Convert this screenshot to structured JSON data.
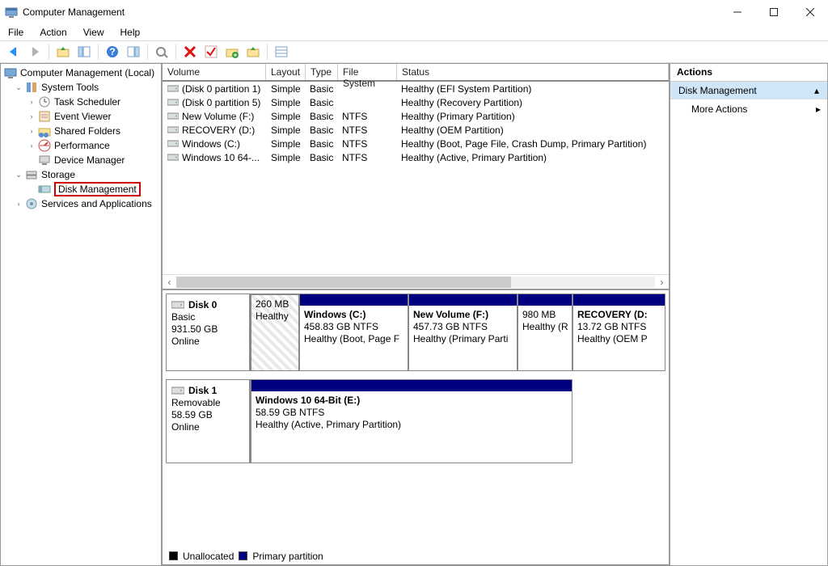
{
  "window": {
    "title": "Computer Management"
  },
  "menu": {
    "file": "File",
    "action": "Action",
    "view": "View",
    "help": "Help"
  },
  "tree": {
    "root": "Computer Management (Local)",
    "system_tools": "System Tools",
    "task_scheduler": "Task Scheduler",
    "event_viewer": "Event Viewer",
    "shared_folders": "Shared Folders",
    "performance": "Performance",
    "device_manager": "Device Manager",
    "storage": "Storage",
    "disk_management": "Disk Management",
    "services_apps": "Services and Applications"
  },
  "vol_headers": {
    "volume": "Volume",
    "layout": "Layout",
    "type": "Type",
    "fs": "File System",
    "status": "Status"
  },
  "volumes": [
    {
      "name": "(Disk 0 partition 1)",
      "layout": "Simple",
      "type": "Basic",
      "fs": "",
      "status": "Healthy (EFI System Partition)"
    },
    {
      "name": "(Disk 0 partition 5)",
      "layout": "Simple",
      "type": "Basic",
      "fs": "",
      "status": "Healthy (Recovery Partition)"
    },
    {
      "name": "New Volume (F:)",
      "layout": "Simple",
      "type": "Basic",
      "fs": "NTFS",
      "status": "Healthy (Primary Partition)"
    },
    {
      "name": "RECOVERY (D:)",
      "layout": "Simple",
      "type": "Basic",
      "fs": "NTFS",
      "status": "Healthy (OEM Partition)"
    },
    {
      "name": "Windows (C:)",
      "layout": "Simple",
      "type": "Basic",
      "fs": "NTFS",
      "status": "Healthy (Boot, Page File, Crash Dump, Primary Partition)"
    },
    {
      "name": "Windows 10 64-...",
      "layout": "Simple",
      "type": "Basic",
      "fs": "NTFS",
      "status": "Healthy (Active, Primary Partition)"
    }
  ],
  "disks": {
    "d0": {
      "name": "Disk 0",
      "type": "Basic",
      "size": "931.50 GB",
      "state": "Online"
    },
    "d1": {
      "name": "Disk 1",
      "type": "Removable",
      "size": "58.59 GB",
      "state": "Online"
    }
  },
  "parts": {
    "d0p1": {
      "name": "",
      "size": "260 MB",
      "status": "Healthy"
    },
    "d0p2": {
      "name": "Windows  (C:)",
      "size": "458.83 GB NTFS",
      "status": "Healthy (Boot, Page F"
    },
    "d0p3": {
      "name": "New Volume  (F:)",
      "size": "457.73 GB NTFS",
      "status": "Healthy (Primary Parti"
    },
    "d0p4": {
      "name": "",
      "size": "980 MB",
      "status": "Healthy (R"
    },
    "d0p5": {
      "name": "RECOVERY  (D:",
      "size": "13.72 GB NTFS",
      "status": "Healthy (OEM P"
    },
    "d1p1": {
      "name": "Windows 10 64-Bit  (E:)",
      "size": "58.59 GB NTFS",
      "status": "Healthy (Active, Primary Partition)"
    }
  },
  "legend": {
    "unallocated": "Unallocated",
    "primary": "Primary partition"
  },
  "actions": {
    "header": "Actions",
    "selected": "Disk Management",
    "more": "More Actions"
  }
}
